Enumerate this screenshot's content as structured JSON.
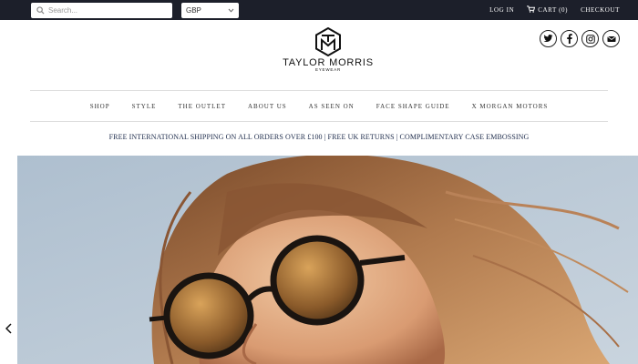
{
  "topbar": {
    "search_placeholder": "Search...",
    "currency": "GBP",
    "login": "LOG IN",
    "cart": "CART (0)",
    "checkout": "CHECKOUT"
  },
  "logo": {
    "brand": "TAYLOR MORRIS",
    "sub": "EYEWEAR"
  },
  "social": [
    "twitter-icon",
    "facebook-icon",
    "instagram-icon",
    "email-icon"
  ],
  "nav": {
    "items": [
      "SHOP",
      "STYLE",
      "THE OUTLET",
      "ABOUT US",
      "AS SEEN ON",
      "FACE SHAPE GUIDE",
      "X MORGAN MOTORS"
    ]
  },
  "promo": "FREE INTERNATIONAL SHIPPING ON ALL ORDERS OVER £100 | FREE UK RETURNS | COMPLIMENTARY CASE EMBOSSING",
  "hero": {
    "image": "woman-wearing-round-sunglasses"
  },
  "colors": {
    "topbar": "#1c1f2a",
    "promo_text": "#1c2a4a"
  }
}
